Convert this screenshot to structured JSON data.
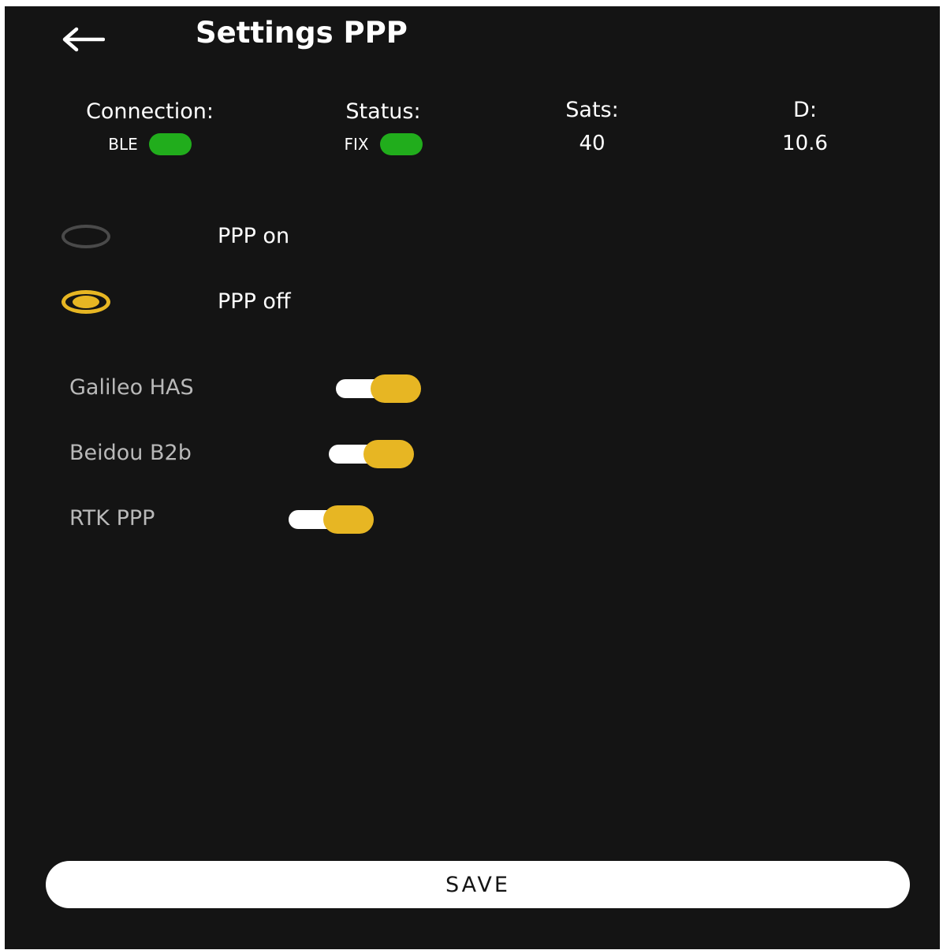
{
  "header": {
    "title": "Settings PPP",
    "back_icon": "arrow-left-icon"
  },
  "status_bar": {
    "connection": {
      "label": "Connection:",
      "value": "BLE",
      "indicator_color": "#21ad1c"
    },
    "status": {
      "label": "Status:",
      "value": "FIX",
      "indicator_color": "#21ad1c"
    },
    "sats": {
      "label": "Sats:",
      "value": "40"
    },
    "d": {
      "label": "D:",
      "value": "10.6"
    }
  },
  "ppp_mode": {
    "options": [
      {
        "label": "PPP on",
        "selected": false
      },
      {
        "label": "PPP off",
        "selected": true
      }
    ]
  },
  "toggles": [
    {
      "label": "Galileo HAS",
      "enabled": true
    },
    {
      "label": "Beidou B2b",
      "enabled": true
    },
    {
      "label": "RTK PPP",
      "enabled": true
    }
  ],
  "save_button": {
    "label": "SAVE"
  },
  "colors": {
    "background": "#141414",
    "accent": "#e7b623",
    "indicator_green": "#21ad1c",
    "text_primary": "#ffffff",
    "text_secondary": "#b9b9b9"
  }
}
